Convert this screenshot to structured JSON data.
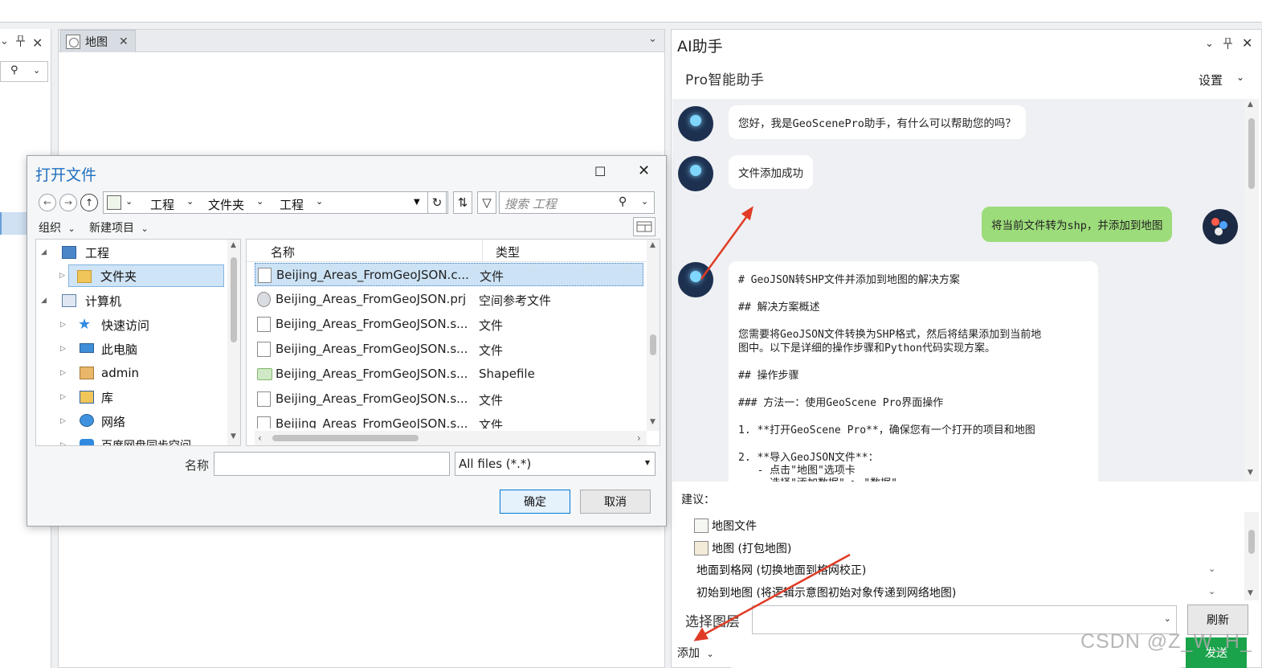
{
  "left_pane": {
    "collapse_icon": "chevron-down",
    "pin_icon": "pin",
    "close_label": "✕"
  },
  "map_pane": {
    "tab_label": "地图",
    "tab_close": "✕",
    "menu_chevron": "⌄"
  },
  "ai_pane": {
    "title": "AI助手",
    "subtitle": "Pro智能助手",
    "settings_label": "设置",
    "messages": [
      {
        "role": "assistant",
        "text": "您好，我是GeoScenePro助手，有什么可以帮助您的吗？"
      },
      {
        "role": "assistant",
        "text": "文件添加成功"
      },
      {
        "role": "user",
        "text": "将当前文件转为shp，并添加到地图"
      }
    ],
    "long_message_lines": [
      "# GeoJSON转SHP文件并添加到地图的解决方案",
      "## 解决方案概述",
      "您需要将GeoJSON文件转换为SHP格式，然后将结果添加到当前地",
      "图中。以下是详细的操作步骤和Python代码实现方案。",
      "## 操作步骤",
      "### 方法一：使用GeoScene Pro界面操作",
      "1. **打开GeoScene Pro**，确保您有一个打开的项目和地图",
      "2. **导入GeoJSON文件**：",
      "   - 点击\"地图\"选项卡",
      "   - 选择\"添加数据\" > \"数据\""
    ],
    "suggestions_label": "建议：",
    "suggestions": [
      "地图文件",
      "地图 (打包地图)",
      "地面到格网 (切换地面到格网校正)",
      "初始到地图 (将逻辑示意图初始对象传递到网络地图)"
    ],
    "layer_label": "选择图层",
    "refresh_label": "刷新",
    "add_label": "添加",
    "send_label": "发送"
  },
  "dialog": {
    "title": "打开文件",
    "address_crumbs": [
      "工程",
      "文件夹",
      "工程"
    ],
    "search_placeholder": "搜索 工程",
    "toolbar": {
      "organize": "组织",
      "new_item": "新建项目"
    },
    "tree": [
      {
        "label": "工程",
        "icon": "project-icon",
        "level": 0,
        "expanded": true
      },
      {
        "label": "文件夹",
        "icon": "folder-icon",
        "level": 1,
        "selected": true
      },
      {
        "label": "计算机",
        "icon": "computer-icon",
        "level": 0,
        "expanded": true
      },
      {
        "label": "快速访问",
        "icon": "star-icon",
        "level": 1
      },
      {
        "label": "此电脑",
        "icon": "pc-icon",
        "level": 1
      },
      {
        "label": "admin",
        "icon": "user-folder-icon",
        "level": 1
      },
      {
        "label": "库",
        "icon": "library-icon",
        "level": 1
      },
      {
        "label": "网络",
        "icon": "network-icon",
        "level": 1
      },
      {
        "label": "百度网盘同步空间",
        "icon": "cloud-icon",
        "level": 1
      }
    ],
    "file_columns": [
      "名称",
      "类型"
    ],
    "files": [
      {
        "name": "Beijing_Areas_FromGeoJSON.c...",
        "type": "文件",
        "selected": true,
        "icon": "file-icon"
      },
      {
        "name": "Beijing_Areas_FromGeoJSON.prj",
        "type": "空间参考文件",
        "icon": "globe-icon"
      },
      {
        "name": "Beijing_Areas_FromGeoJSON.s...",
        "type": "文件",
        "icon": "file-icon"
      },
      {
        "name": "Beijing_Areas_FromGeoJSON.s...",
        "type": "文件",
        "icon": "file-icon"
      },
      {
        "name": "Beijing_Areas_FromGeoJSON.s...",
        "type": "Shapefile",
        "icon": "shapefile-icon"
      },
      {
        "name": "Beijing_Areas_FromGeoJSON.s...",
        "type": "文件",
        "icon": "file-icon"
      },
      {
        "name": "Beijing_Areas_FromGeoJSON.s...",
        "type": "文件",
        "icon": "file-icon"
      }
    ],
    "name_label": "名称",
    "name_value": "",
    "filter_value": "All files (*.*)",
    "ok_label": "确定",
    "cancel_label": "取消"
  },
  "watermark": "CSDN @Z_W_H_",
  "colors": {
    "accent_blue": "#1e6fbf",
    "user_bubble": "#9ddc7b",
    "send_green": "#1aa34a",
    "arrow_red": "#e03b26"
  }
}
